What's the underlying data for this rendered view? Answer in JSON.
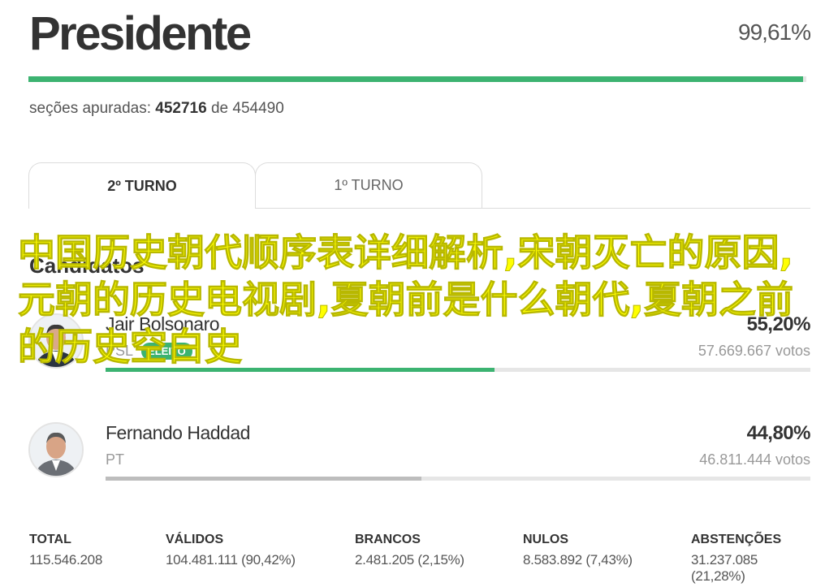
{
  "header": {
    "title": "Presidente",
    "percent_counted": "99,61%",
    "progress_fraction": 0.9961,
    "secoes_label": "seções apuradas:",
    "secoes_count": "452716",
    "secoes_of": "de",
    "secoes_total": "454490"
  },
  "tabs": [
    {
      "label": "2º TURNO",
      "active": true
    },
    {
      "label": "1º TURNO",
      "active": false
    }
  ],
  "candidates_heading": "Candidatos",
  "candidates": [
    {
      "name": "Jair Bolsonaro",
      "party": "PSL",
      "badge": "ELEITO",
      "percent": "55,20%",
      "votes": "57.669.667 votos",
      "share": 0.552,
      "bar_color": "#3cb371"
    },
    {
      "name": "Fernando Haddad",
      "party": "PT",
      "percent": "44,80%",
      "votes": "46.811.444 votos",
      "share": 0.448,
      "bar_color": "#bdbdbd"
    }
  ],
  "stats": [
    {
      "label": "TOTAL",
      "value": "115.546.208"
    },
    {
      "label": "VÁLIDOS",
      "value": "104.481.111 (90,42%)"
    },
    {
      "label": "BRANCOS",
      "value": "2.481.205 (2,15%)"
    },
    {
      "label": "NULOS",
      "value": "8.583.892 (7,43%)"
    },
    {
      "label": "ABSTENÇÕES",
      "value": "31.237.085 (21,28%)"
    }
  ],
  "overlay_text": "中国历史朝代顺序表详细解析,宋朝灭亡的原因,元朝的历史电视剧,夏朝前是什么朝代,夏朝之前的历史空白史",
  "colors": {
    "accent": "#3cb371",
    "overlay": "#ffff00"
  }
}
